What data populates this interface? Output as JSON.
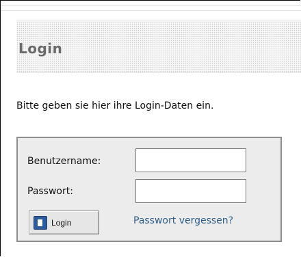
{
  "title": "Login",
  "intro_text": "Bitte geben sie hier ihre Login-Daten ein.",
  "form": {
    "username_label": "Benutzername:",
    "username_value": "",
    "password_label": "Passwort:",
    "password_value": "",
    "login_button_label": "Login",
    "login_button_icon": "login-door-icon",
    "forgot_password_link": "Passwort vergessen?"
  },
  "colors": {
    "title_text": "#6a6a6a",
    "link": "#2f5d8a",
    "box_background": "#ececec",
    "box_border": "#8e8e8e",
    "button_icon": "#2d5d9c"
  }
}
